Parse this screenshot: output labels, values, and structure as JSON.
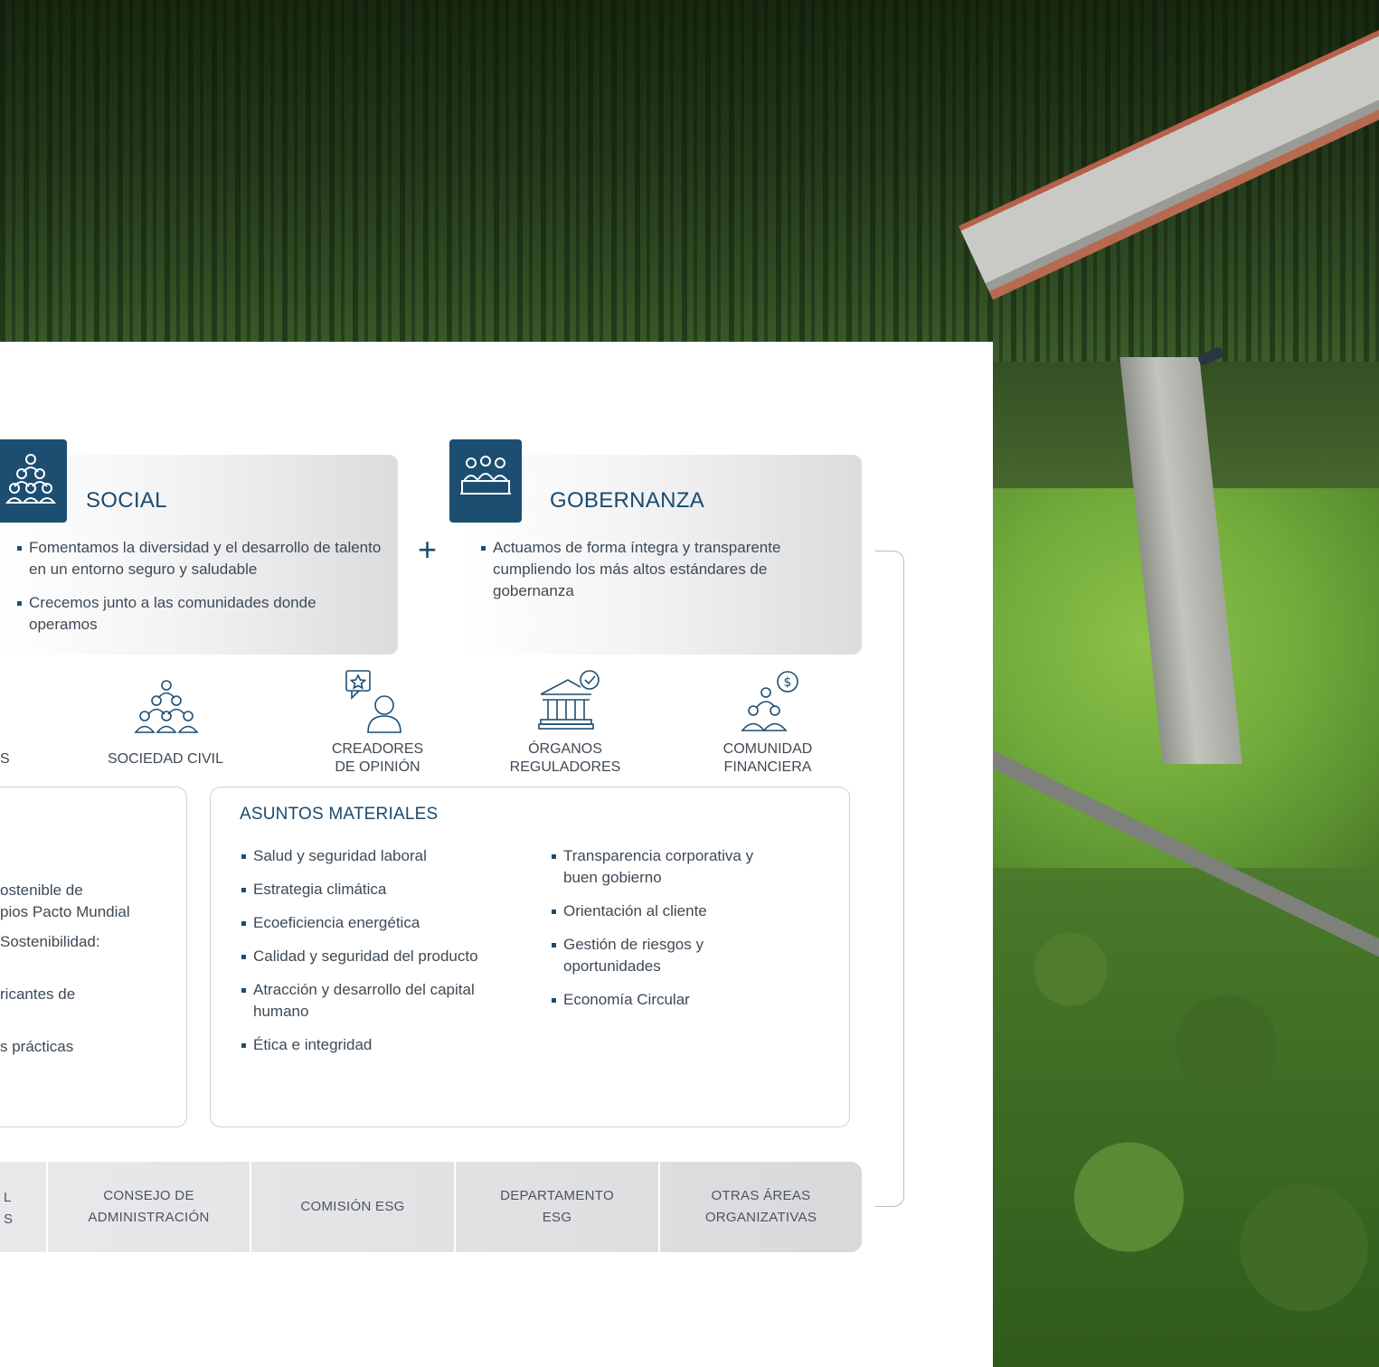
{
  "social": {
    "title": "SOCIAL",
    "bullets": [
      "Fomentamos la diversidad y el desarrollo de talento en un entorno seguro y saludable",
      "Crecemos junto a las comunidades donde operamos"
    ]
  },
  "plus_sign": "+",
  "governance": {
    "title": "GOBERNANZA",
    "bullets": [
      "Actuamos de forma íntegra y transparente cumpliendo los más altos estándares de gobernanza"
    ]
  },
  "stakeholders": {
    "partial": "ES",
    "civil_society": "SOCIEDAD CIVIL",
    "opinion_makers": [
      "CREADORES",
      "DE OPINIÓN"
    ],
    "regulators": [
      "ÓRGANOS",
      "REGULADORES"
    ],
    "financial_community": [
      "COMUNIDAD",
      "FINANCIERA"
    ]
  },
  "left_box": {
    "lines": [
      "ostenible de",
      "pios Pacto Mundial",
      "Sostenibilidad:",
      "ricantes de",
      "s prácticas"
    ]
  },
  "material_issues": {
    "title": "ASUNTOS MATERIALES",
    "column1": [
      "Salud y seguridad laboral",
      "Estrategia climática",
      "Ecoeficiencia energética",
      "Calidad y seguridad del producto",
      "Atracción y desarrollo del capital humano",
      "Ética e integridad"
    ],
    "column2": [
      "Transparencia corporativa y buen gobierno",
      "Orientación al cliente",
      "Gestión de riesgos y oportunidades",
      "Economía Circular"
    ]
  },
  "governance_bar": {
    "partial_lines": [
      "L",
      "S"
    ],
    "board": [
      "CONSEJO DE",
      "ADMINISTRACIÓN"
    ],
    "esg_committee": "COMISIÓN ESG",
    "esg_department": [
      "DEPARTAMENTO",
      "ESG"
    ],
    "other_areas": [
      "OTRAS ÁREAS",
      "ORGANIZATIVAS"
    ]
  },
  "colors": {
    "primary": "#1d4e72",
    "text": "#3d4a55",
    "border": "#cfd2d6"
  }
}
